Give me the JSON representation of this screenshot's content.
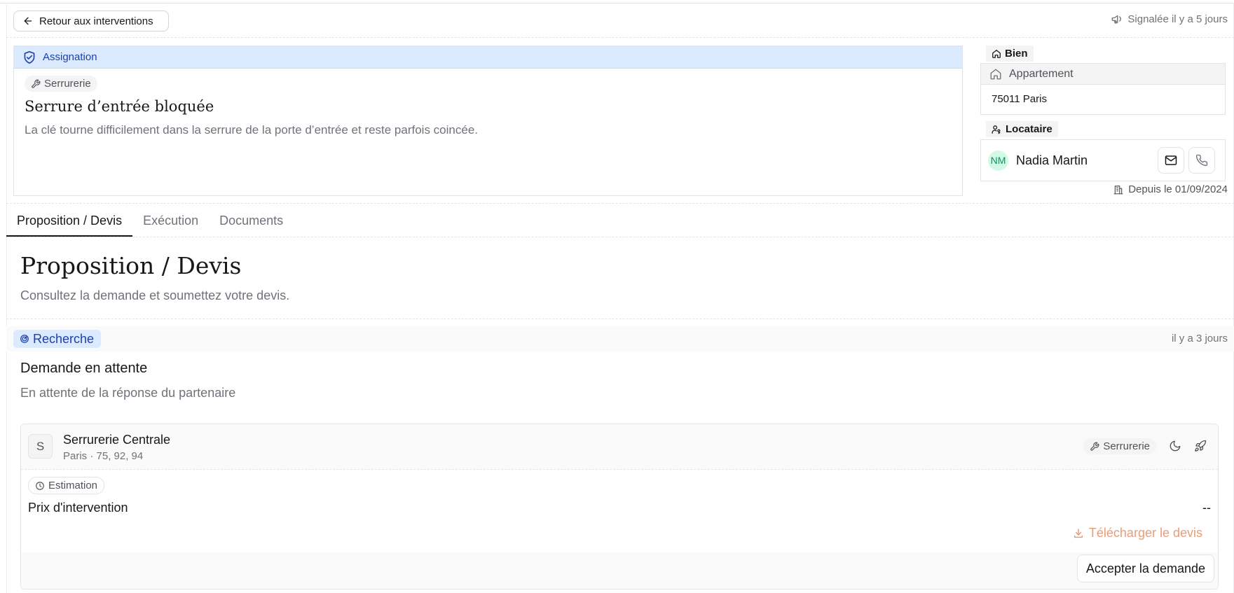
{
  "header": {
    "back_label": "Retour aux interventions",
    "reported": "Signalée il y a 5 jours"
  },
  "assignment": {
    "header_label": "Assignation",
    "category": "Serrurerie",
    "title": "Serrure d’entrée bloquée",
    "description": "La clé tourne difficilement dans la serrure de la porte d’entrée et reste parfois coincée."
  },
  "property": {
    "label": "Bien",
    "type": "Appartement",
    "city": "75011 Paris"
  },
  "tenant": {
    "label": "Locataire",
    "initials": "NM",
    "name": "Nadia Martin",
    "since": "Depuis le 01/09/2024"
  },
  "tabs": [
    {
      "label": "Proposition / Devis",
      "active": true
    },
    {
      "label": "Exécution",
      "active": false
    },
    {
      "label": "Documents",
      "active": false
    }
  ],
  "section": {
    "title": "Proposition / Devis",
    "subtitle": "Consultez la demande et soumettez votre devis."
  },
  "status": {
    "badge": "Recherche",
    "time": "il y a 3 jours"
  },
  "request": {
    "title": "Demande en attente",
    "subtitle": "En attente de la réponse du partenaire"
  },
  "partner": {
    "initial": "S",
    "name": "Serrurerie Centrale",
    "location": "Paris · 75, 92, 94",
    "category": "Serrurerie",
    "estimate_label": "Estimation",
    "price_label": "Prix d'intervention",
    "price_value": "--",
    "download_label": "Télécharger le devis",
    "accept_label": "Accepter la demande"
  },
  "colors": {
    "accent_blue": "#1e40af",
    "accent_blue_bg": "#dbeafe",
    "download_orange": "#ea9c76",
    "tenant_green": "#059669"
  }
}
